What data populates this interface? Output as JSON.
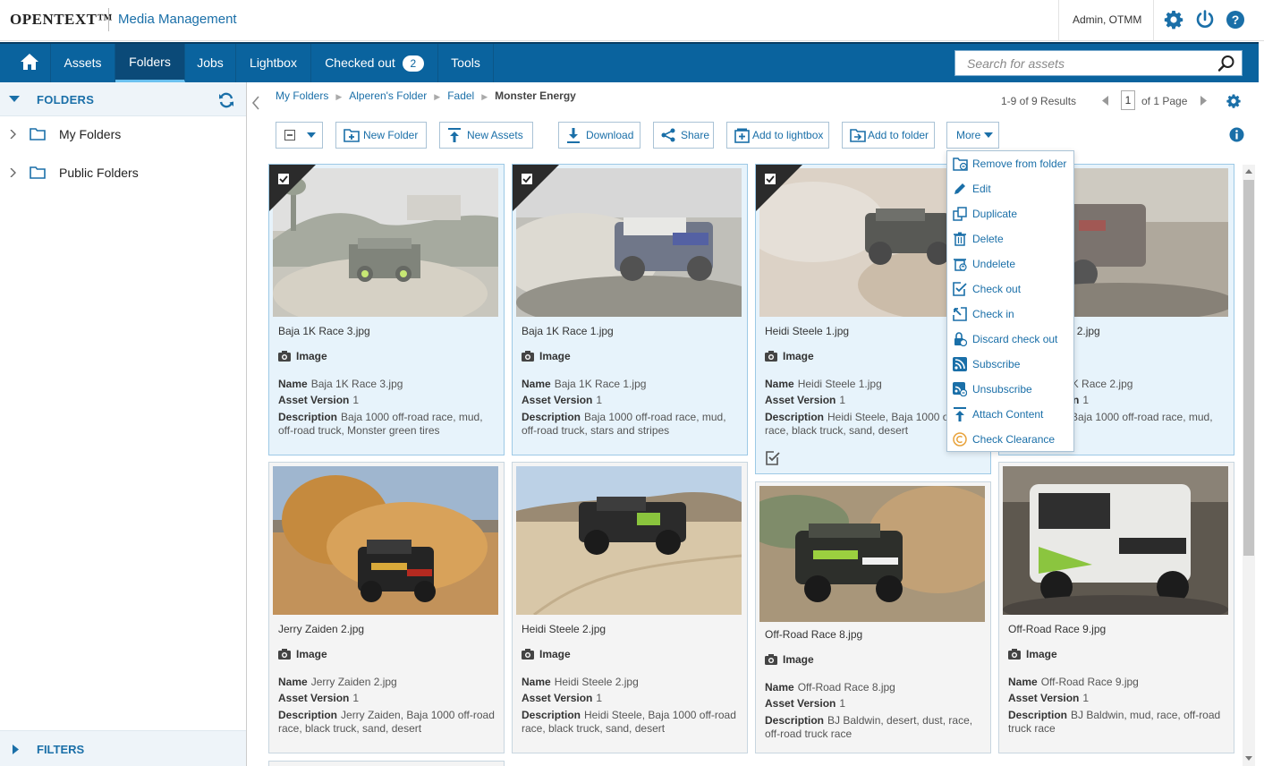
{
  "header": {
    "logo": "OPENTEXT™",
    "product": "Media Management",
    "user": "Admin, OTMM"
  },
  "nav": {
    "items": [
      "Assets",
      "Folders",
      "Jobs",
      "Lightbox",
      "Checked out",
      "Tools"
    ],
    "active": "Folders",
    "checked_out_count": "2",
    "search_placeholder": "Search for assets"
  },
  "left_panel": {
    "title": "FOLDERS",
    "tree": [
      "My Folders",
      "Public Folders"
    ],
    "filters_title": "FILTERS"
  },
  "breadcrumb": [
    "My Folders",
    "Alperen's Folder",
    "Fadel",
    "Monster Energy"
  ],
  "results": {
    "summary": "1-9 of 9 Results",
    "page": "1",
    "page_total": "of 1 Page"
  },
  "toolbar": {
    "new_folder": "New Folder",
    "new_assets": "New Assets",
    "download": "Download",
    "share": "Share",
    "add_to_lightbox": "Add to lightbox",
    "add_to_folder": "Add to folder",
    "more": "More"
  },
  "more_menu": [
    "Remove from folder",
    "Edit",
    "Duplicate",
    "Delete",
    "Undelete",
    "Check out",
    "Check in",
    "Discard check out",
    "Subscribe",
    "Unsubscribe",
    "Attach Content",
    "Check Clearance"
  ],
  "labels": {
    "name": "Name",
    "asset_version": "Asset Version",
    "description": "Description"
  },
  "assets": [
    {
      "title": "Baja 1K Race 3.jpg",
      "type": "Image",
      "name": "Baja 1K Race 3.jpg",
      "version": "1",
      "description": "Baja 1000 off-road race, mud, off-road truck, Monster green tires",
      "selected": true
    },
    {
      "title": "Baja 1K Race 1.jpg",
      "type": "Image",
      "name": "Baja 1K Race 1.jpg",
      "version": "1",
      "description": "Baja 1000 off-road race, mud, off-road truck, stars and stripes",
      "selected": true
    },
    {
      "title": "Heidi Steele 1.jpg",
      "type": "Image",
      "name": "Heidi Steele 1.jpg",
      "version": "1",
      "description": "Heidi Steele, Baja 1000 off-road race, black truck, sand, desert",
      "selected": true
    },
    {
      "title": "Baja 1K Race 2.jpg",
      "type": "Image",
      "name": "Baja 1K Race 2.jpg",
      "version": "1",
      "description": "Baja 1000 off-road race, mud,",
      "selected": true
    },
    {
      "title": "Jerry Zaiden 2.jpg",
      "type": "Image",
      "name": "Jerry Zaiden 2.jpg",
      "version": "1",
      "description": "Jerry Zaiden, Baja 1000 off-road race, black truck, sand, desert",
      "selected": false
    },
    {
      "title": "Heidi Steele 2.jpg",
      "type": "Image",
      "name": "Heidi Steele 2.jpg",
      "version": "1",
      "description": "Heidi Steele, Baja 1000 off-road race, black truck, sand, desert",
      "selected": false
    },
    {
      "title": "Off-Road Race 8.jpg",
      "type": "Image",
      "name": "Off-Road Race 8.jpg",
      "version": "1",
      "description": "BJ Baldwin, desert, dust, race, off-road truck race",
      "selected": false
    },
    {
      "title": "Off-Road Race 9.jpg",
      "type": "Image",
      "name": "Off-Road Race 9.jpg",
      "version": "1",
      "description": "BJ Baldwin, mud, race, off-road truck race",
      "selected": false
    }
  ]
}
